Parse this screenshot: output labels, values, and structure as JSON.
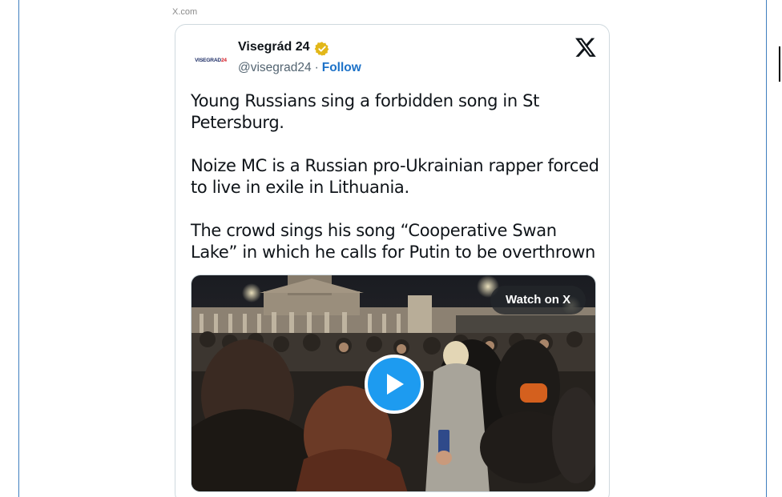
{
  "source_label": "X.com",
  "tweet": {
    "avatar": {
      "text_main": "VISEGRAD",
      "text_num": "24"
    },
    "author_name": "Visegrád 24",
    "handle": "@visegrad24",
    "separator": "·",
    "follow_label": "Follow",
    "paragraphs": [
      "Young Russians sing a forbidden song in St Petersburg.",
      "Noize MC is a Russian pro-Ukrainian rapper forced to live in exile in Lithuania.",
      "The crowd sings his song “Cooperative Swan Lake” in which he calls for Putin to be overthrown"
    ],
    "video": {
      "watch_label": "Watch on X"
    }
  },
  "icons": {
    "verified": "verified-badge-icon",
    "brand": "x-logo-icon",
    "play": "play-icon"
  },
  "colors": {
    "frame": "#3f7fbf",
    "follow": "#1d72c8",
    "play_button": "#1d9bf0",
    "verified_gold": "#e2b719",
    "text": "#0f1419",
    "muted": "#536471"
  }
}
